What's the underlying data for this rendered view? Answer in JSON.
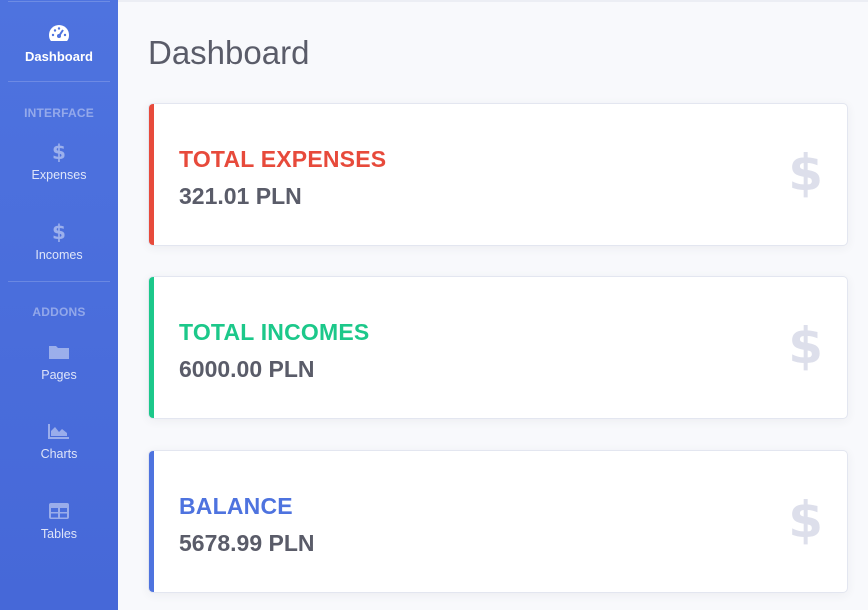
{
  "sidebar": {
    "items": [
      {
        "label": "Dashboard",
        "icon": "tachometer-icon"
      },
      {
        "label": "Expenses",
        "icon": "dollar-icon"
      },
      {
        "label": "Incomes",
        "icon": "dollar-icon"
      },
      {
        "label": "Pages",
        "icon": "folder-icon"
      },
      {
        "label": "Charts",
        "icon": "area-chart-icon"
      },
      {
        "label": "Tables",
        "icon": "table-icon"
      }
    ],
    "headings": {
      "interface": "INTERFACE",
      "addons": "ADDONS"
    }
  },
  "main": {
    "title": "Dashboard",
    "cards": [
      {
        "label": "TOTAL EXPENSES",
        "value": "321.01 PLN",
        "color": "#e74a3b"
      },
      {
        "label": "TOTAL INCOMES",
        "value": "6000.00 PLN",
        "color": "#1cc88a"
      },
      {
        "label": "BALANCE",
        "value": "5678.99 PLN",
        "color": "#4e73df"
      }
    ]
  },
  "colors": {
    "sidebar": "#4e73df",
    "background": "#f8f9fc",
    "text": "#5a5c69",
    "icon_muted": "#dddfeb"
  }
}
